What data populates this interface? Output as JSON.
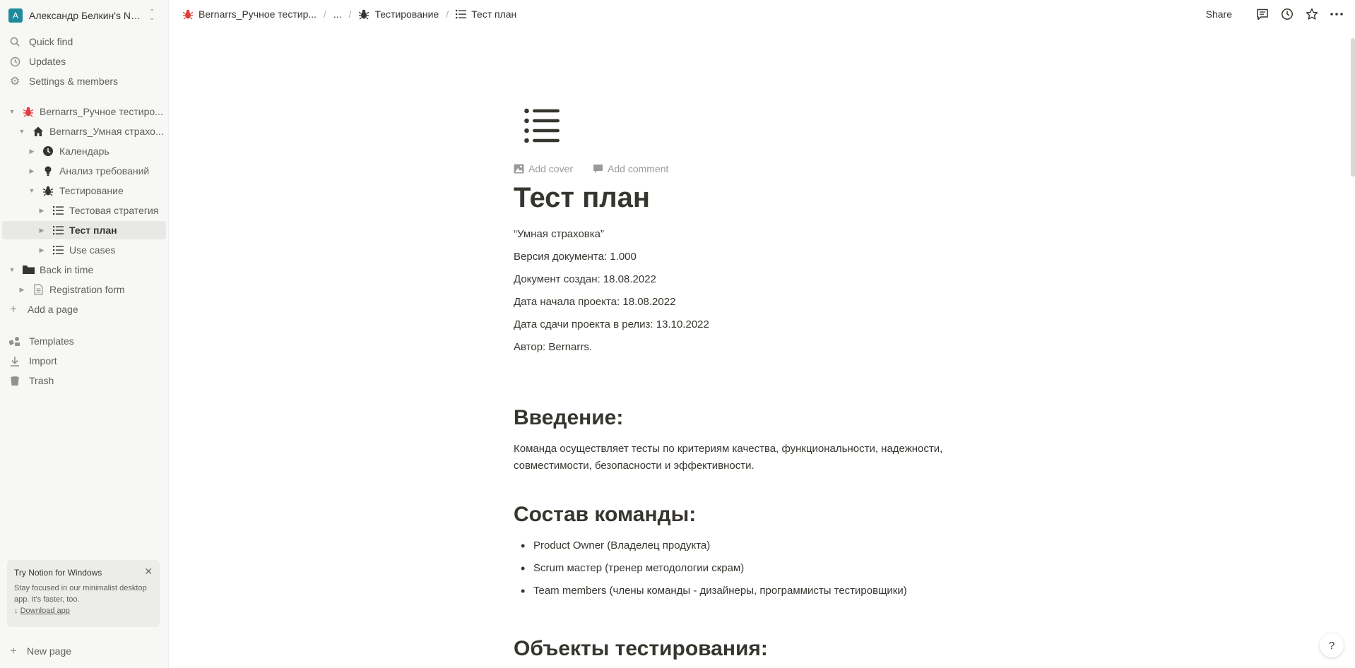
{
  "sidebar": {
    "workspace_initial": "А",
    "workspace_name": "Александр Белкин's Not...",
    "quick_find": "Quick find",
    "updates": "Updates",
    "settings": "Settings & members",
    "tree": {
      "root": "Bernarrs_Ручное тестиро...",
      "insurance": "Bernarrs_Умная страхо...",
      "calendar": "Календарь",
      "analysis": "Анализ требований",
      "testing": "Тестирование",
      "strategy": "Тестовая стратегия",
      "testplan": "Тест план",
      "usecases": "Use cases",
      "backintime": "Back in time",
      "regform": "Registration form"
    },
    "add_page": "Add a page",
    "templates": "Templates",
    "import": "Import",
    "trash": "Trash",
    "promo": {
      "title": "Try Notion for Windows",
      "body": "Stay focused in our minimalist desktop app. It's faster, too.",
      "link": "Download app"
    },
    "new_page": "New page"
  },
  "topbar": {
    "crumb1": "Bernarrs_Ручное тестир...",
    "crumb_ellipsis": "...",
    "crumb2": "Тестирование",
    "crumb3": "Тест план",
    "share": "Share"
  },
  "doc": {
    "add_cover": "Add cover",
    "add_comment": "Add comment",
    "title": "Тест план",
    "lines": {
      "l1": "“Умная страховка”",
      "l2": "Версия документа: 1.000",
      "l3": "Документ создан: 18.08.2022",
      "l4": "Дата начала проекта: 18.08.2022",
      "l5": "Дата сдачи проекта в релиз: 13.10.2022",
      "l6": "Автор: Bernarrs."
    },
    "h_intro": "Введение:",
    "intro_text": "Команда осуществляет тесты по критериям качества, функциональности, надежности, совместимости, безопасности и эффективности.",
    "h_team": "Состав команды:",
    "team": {
      "b1": "Product Owner (Владелец продукта)",
      "b2": "Scrum мастер (тренер методологии скрам)",
      "b3": "Team members (члены команды - дизайнеры, программисты тестировщики)"
    },
    "h_objects": "Объекты тестирования:"
  },
  "help_label": "?"
}
